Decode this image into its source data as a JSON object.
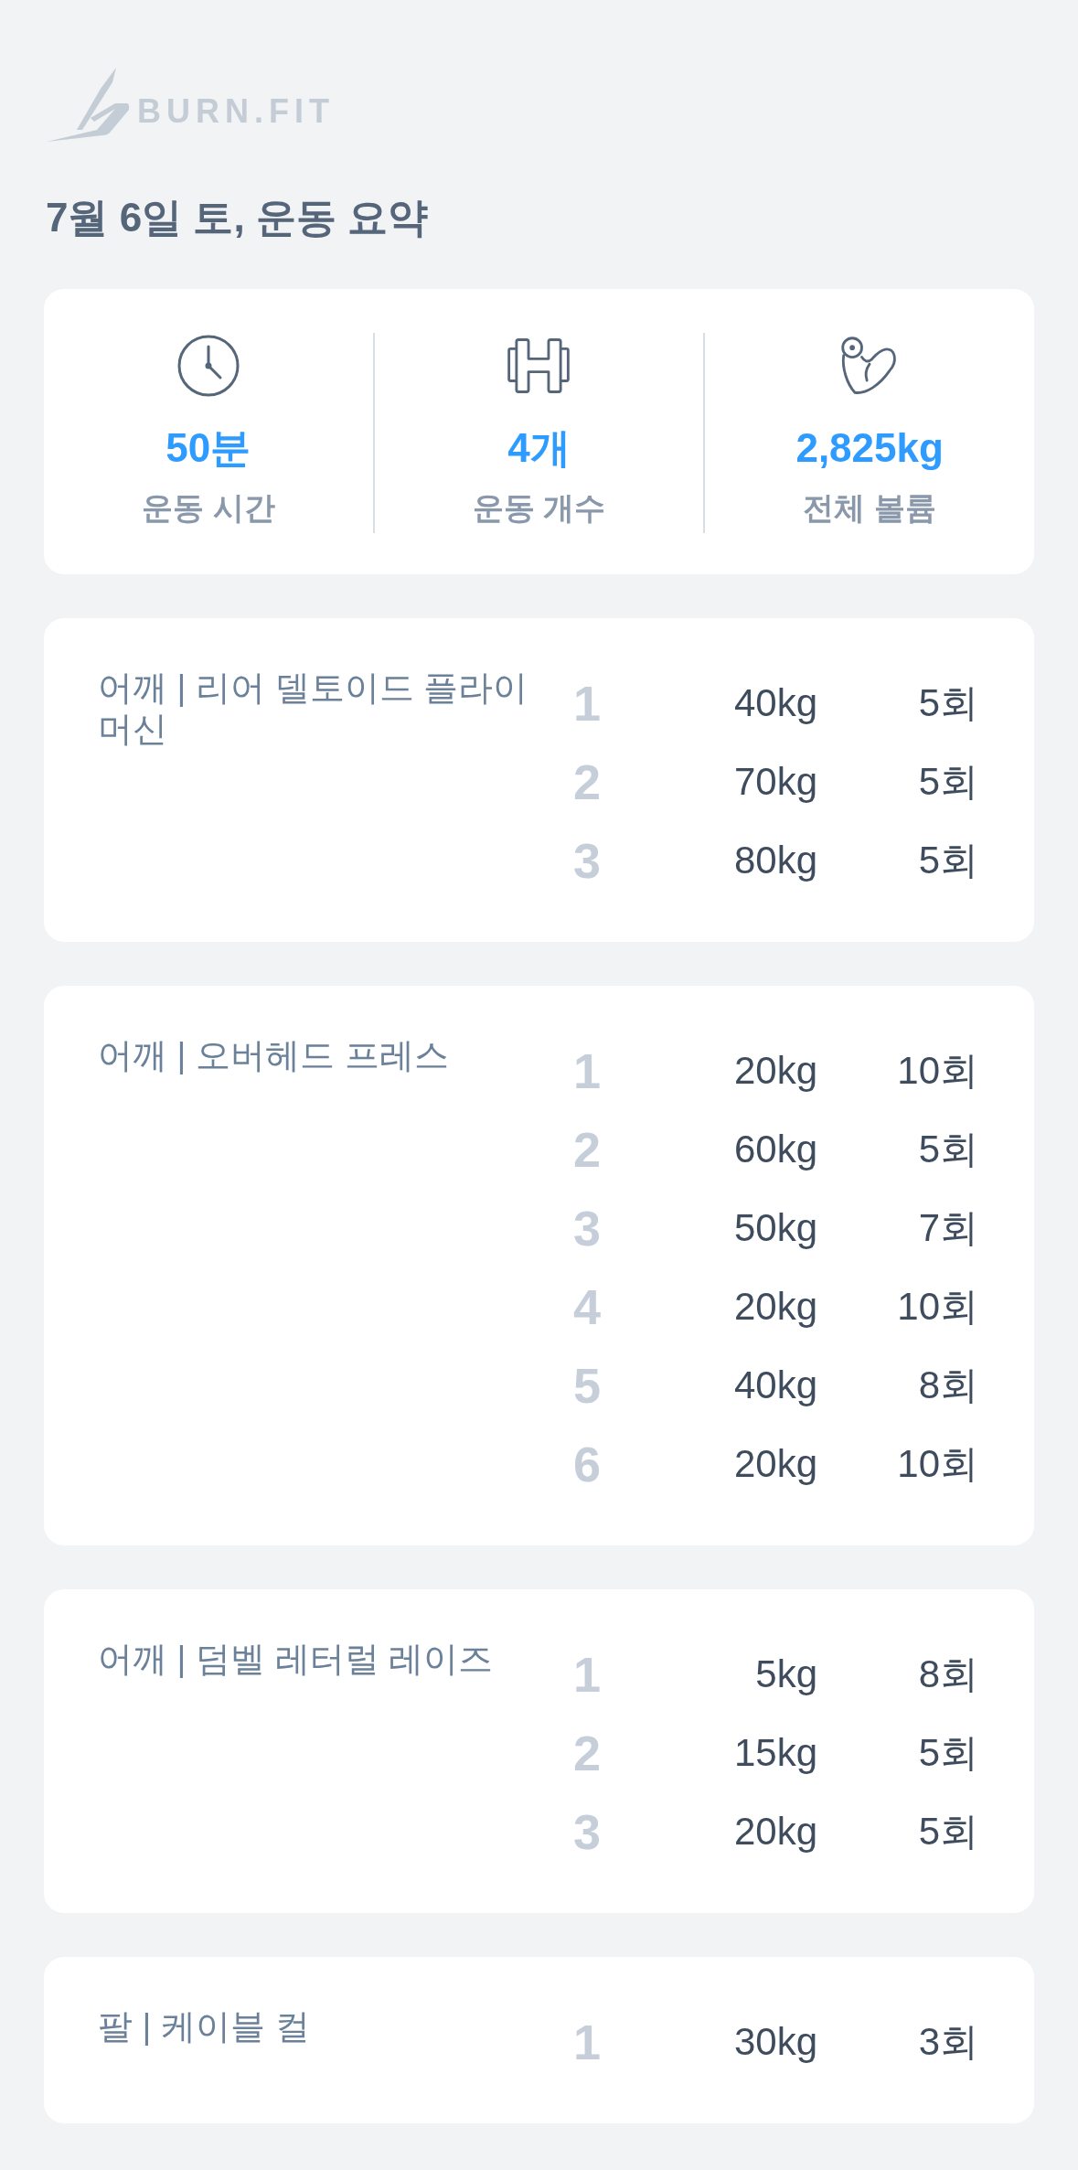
{
  "logo": {
    "text": "BURN.FIT"
  },
  "title": "7월 6일 토, 운동 요약",
  "summary": [
    {
      "kind": "time",
      "value": "50분",
      "label": "운동 시간"
    },
    {
      "kind": "count",
      "value": "4개",
      "label": "운동 개수"
    },
    {
      "kind": "volume",
      "value": "2,825kg",
      "label": "전체 볼륨"
    }
  ],
  "exercises": [
    {
      "name": "어깨 | 리어 델토이드 플라이 머신",
      "sets": [
        {
          "number": "1",
          "weight": "40kg",
          "reps": "5회"
        },
        {
          "number": "2",
          "weight": "70kg",
          "reps": "5회"
        },
        {
          "number": "3",
          "weight": "80kg",
          "reps": "5회"
        }
      ]
    },
    {
      "name": "어깨 | 오버헤드 프레스",
      "sets": [
        {
          "number": "1",
          "weight": "20kg",
          "reps": "10회"
        },
        {
          "number": "2",
          "weight": "60kg",
          "reps": "5회"
        },
        {
          "number": "3",
          "weight": "50kg",
          "reps": "7회"
        },
        {
          "number": "4",
          "weight": "20kg",
          "reps": "10회"
        },
        {
          "number": "5",
          "weight": "40kg",
          "reps": "8회"
        },
        {
          "number": "6",
          "weight": "20kg",
          "reps": "10회"
        }
      ]
    },
    {
      "name": "어깨 | 덤벨 레터럴 레이즈",
      "sets": [
        {
          "number": "1",
          "weight": "5kg",
          "reps": "8회"
        },
        {
          "number": "2",
          "weight": "15kg",
          "reps": "5회"
        },
        {
          "number": "3",
          "weight": "20kg",
          "reps": "5회"
        }
      ]
    },
    {
      "name": "팔 | 케이블 컬",
      "sets": [
        {
          "number": "1",
          "weight": "30kg",
          "reps": "3회"
        }
      ]
    }
  ]
}
